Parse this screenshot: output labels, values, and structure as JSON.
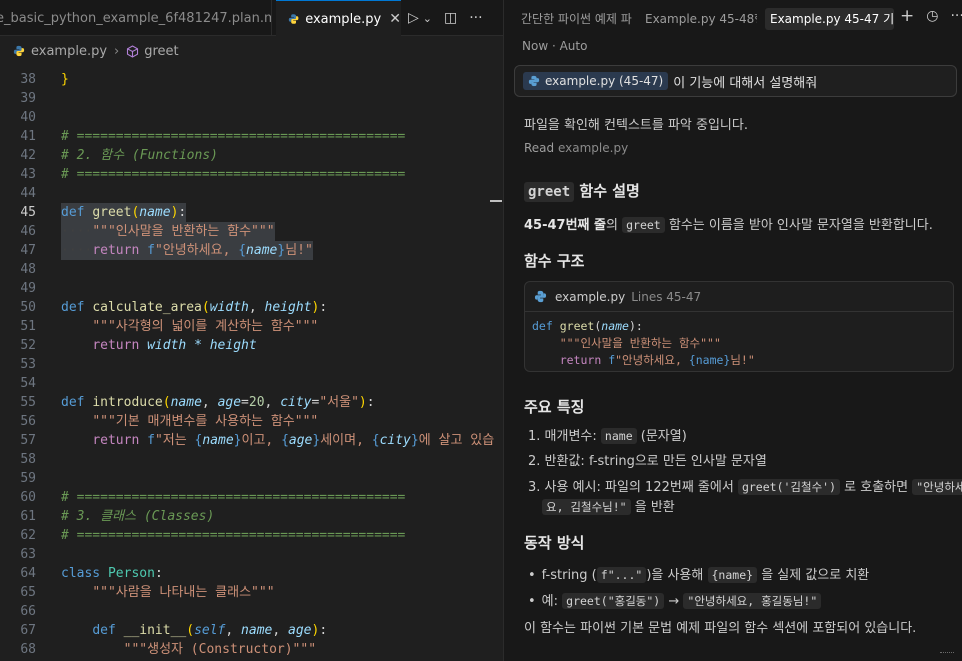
{
  "editor": {
    "tabs": [
      {
        "label": "e_basic_python_example_6f481247.plan.md"
      },
      {
        "label": "example.py",
        "close": "✕"
      }
    ],
    "actions": {
      "run": "▷",
      "run_menu": "⌄",
      "split": "◫",
      "more": "···"
    },
    "breadcrumb": {
      "file": "example.py",
      "symbol": "greet"
    },
    "line_numbers": [
      "38",
      "39",
      "40",
      "41",
      "42",
      "43",
      "44",
      "45",
      "46",
      "47",
      "48",
      "49",
      "50",
      "51",
      "52",
      "53",
      "54",
      "55",
      "56",
      "57",
      "58",
      "59",
      "60",
      "61",
      "62",
      "63",
      "64",
      "65",
      "66",
      "67",
      "68"
    ],
    "code": {
      "l38": "}",
      "l41": "# ==========================================",
      "l42": "# 2. 함수 (Functions)",
      "l43": "# ==========================================",
      "l45_def": "def",
      "l45_fn": "greet",
      "l45_param": "name",
      "l46_ws": "····",
      "l46": "\"\"\"인사말을 반환하는 함수\"\"\"",
      "l47_ws": "····",
      "l47_ret": "return",
      "l47_f": "f",
      "l47_a": "\"안녕하세요, ",
      "l47_var": "name",
      "l47_b": "님!\"",
      "l50_fn": "calculate_area",
      "l50_p1": "width",
      "l50_p2": "height",
      "l51": "\"\"\"사각형의 넓이를 계산하는 함수\"\"\"",
      "l52_ret": "return",
      "l52_expr": "width * height",
      "l55_fn": "introduce",
      "l55_p1": "name",
      "l55_p2": "age",
      "l55_v2": "20",
      "l55_p3": "city",
      "l55_v3": "\"서울\"",
      "l56": "\"\"\"기본 매개변수를 사용하는 함수\"\"\"",
      "l57_ret": "return",
      "l57_f": "f",
      "l57_a": "\"저는 ",
      "l57_v1": "name",
      "l57_b": "이고, ",
      "l57_v2": "age",
      "l57_c": "세이며, ",
      "l57_v3": "city",
      "l57_d": "에 살고 있습",
      "l60": "# ==========================================",
      "l61": "# 3. 클래스 (Classes)",
      "l62": "# ==========================================",
      "l64_kw": "class",
      "l64_cl": "Person",
      "l65": "\"\"\"사람을 나타내는 클래스\"\"\"",
      "l67_def": "def",
      "l67_fn": "__init__",
      "l67_self": "self",
      "l67_p1": "name",
      "l67_p2": "age",
      "l68": "\"\"\"생성자 (Constructor)\"\"\""
    }
  },
  "chat": {
    "tabs": [
      "간단한 파이썬 예제 파",
      "Example.py 45-48행",
      "Example.py 45-47 기능"
    ],
    "actions": {
      "new": "+",
      "history": "◷",
      "more": "···"
    },
    "meta": "Now · Auto",
    "prompt": {
      "chip": "example.py (45-47)",
      "text": "이 기능에 대해서 설명해줘"
    },
    "status": "파일을 확인해 컨텍스트를 파악 중입니다.",
    "read": {
      "label": "Read",
      "file": "example.py"
    },
    "heading1": {
      "code": "greet",
      "text": "함수 설명"
    },
    "intro": {
      "bold": "45-47번째 줄",
      "mid": "의",
      "code": "greet",
      "rest": "함수는 이름을 받아 인사말 문자열을 반환합니다."
    },
    "heading2": "함수 구조",
    "code_card": {
      "file": "example.py",
      "lines": "Lines 45-47",
      "l1_def": "def",
      "l1_fn": "greet",
      "l1_param": "name",
      "l2": "\"\"\"인사말을 반환하는 함수\"\"\"",
      "l3_ret": "return",
      "l3_f": "f",
      "l3_a": "\"안녕하세요, ",
      "l3_var": "{name}",
      "l3_b": "님!\""
    },
    "heading3": "주요 특징",
    "features": [
      {
        "num": "1.",
        "label": "매개변수:",
        "code": "name",
        "rest": "(문자열)"
      },
      {
        "num": "2.",
        "label": "반환값:",
        "rest": "f-string으로 만든 인사말 문자열"
      },
      {
        "num": "3.",
        "label": "사용 예시:",
        "mid": "파일의 122번째 줄에서",
        "code": "greet('김철수')",
        "mid2": "로 호출하면",
        "code2": "\"안녕하세",
        "code3": "요, 김철수님!\"",
        "rest": "을 반환"
      }
    ],
    "heading4": "동작 방식",
    "behaviors": [
      {
        "pre": "f-string (",
        "code": "f\"...\"",
        "mid": ")을 사용해",
        "code2": "{name}",
        "rest": "을 실제 값으로 치환"
      },
      {
        "pre": "예:",
        "code": "greet(\"홍길동\")",
        "arrow": "→",
        "code2": "\"안녕하세요, 홍길동님!\""
      }
    ],
    "footer": "이 함수는 파이썬 기본 문법 예제 파일의 함수 섹션에 포함되어 있습니다."
  }
}
